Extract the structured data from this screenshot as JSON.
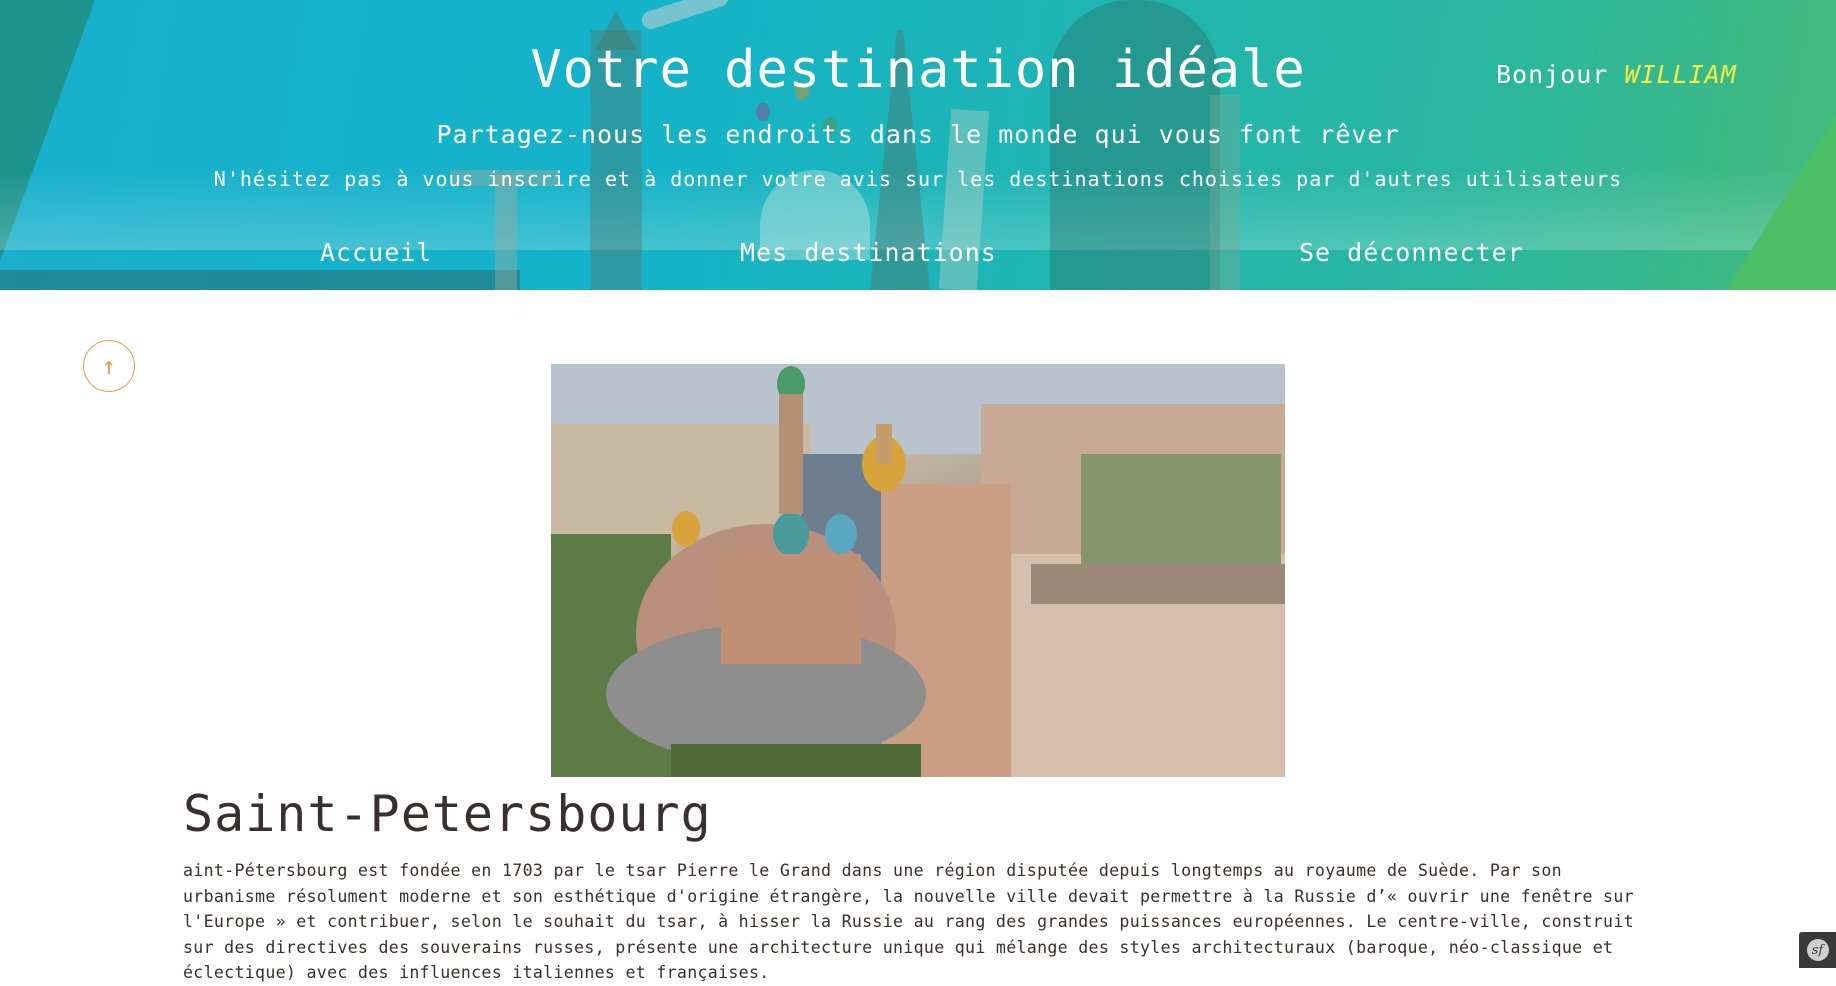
{
  "header": {
    "title": "Votre destination idéale",
    "subtitle": "Partagez-nous les endroits dans le monde qui vous font rêver",
    "tagline": "N'hésitez pas à vous inscrire et à donner votre avis sur les destinations choisies par d'autres utilisateurs",
    "greeting_prefix": "Bonjour",
    "username": "WILLIAM"
  },
  "nav": {
    "items": [
      {
        "label": "Accueil"
      },
      {
        "label": "Mes destinations"
      },
      {
        "label": "Se déconnecter"
      }
    ]
  },
  "content": {
    "scroll_top_icon": "↑",
    "place_title": "Saint-Petersbourg",
    "description": "aint-Pétersbourg est fondée en 1703 par le tsar Pierre le Grand dans une région disputée depuis longtemps au royaume de Suède. Par son urbanisme résolument moderne et son esthétique d'origine étrangère, la nouvelle ville devait permettre à la Russie d’« ouvrir une fenêtre sur l'Europe » et contribuer, selon le souhait du tsar, à hisser la Russie au rang des grandes puissances européennes. Le centre-ville, construit sur des directives des souverains russes, présente une architecture unique qui mélange des styles architecturaux (baroque, néo-classique et éclectique) avec des influences italiennes et françaises."
  },
  "debug_toolbar": {
    "icon": "sf"
  },
  "colors": {
    "accent": "#f09a45",
    "username": "#f3ec4a",
    "text": "#3a2f2f"
  }
}
